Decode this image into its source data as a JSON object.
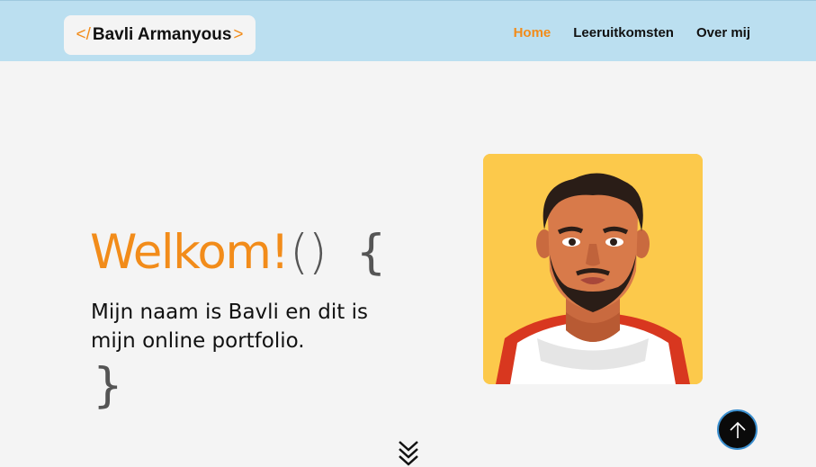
{
  "header": {
    "logo": {
      "open": "</",
      "name": "Bavli Armanyous",
      "close": ">"
    },
    "nav": [
      {
        "label": "Home",
        "active": true
      },
      {
        "label": "Leeruitkomsten",
        "active": false
      },
      {
        "label": "Over mij",
        "active": false
      }
    ]
  },
  "hero": {
    "title": "Welkom!",
    "parens": "()",
    "brace_open": "{",
    "intro": "Mijn naam is Bavli en dit is mijn online portfolio.",
    "brace_close": "}"
  },
  "icons": {
    "scroll_down": "chevrons-down-icon",
    "scroll_top": "arrow-up-icon"
  },
  "colors": {
    "accent": "#f28c1a",
    "header_bg": "#bbdff0",
    "portrait_bg": "#fcc94b",
    "page_bg": "#f4f4f4"
  }
}
